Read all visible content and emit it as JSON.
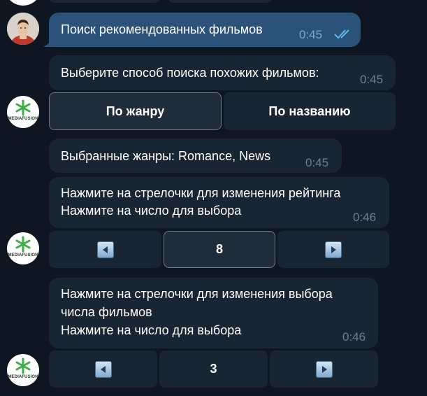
{
  "messages": {
    "user_query": {
      "text": "Поиск рекомендованных фильмов",
      "time": "0:45"
    },
    "choose_method": {
      "text": "Выберите способ поиска похожих фильмов:",
      "time": "0:45"
    },
    "method_buttons": [
      "По жанру",
      "По названию"
    ],
    "genres": {
      "text": "Выбранные жанры: Romance, News",
      "time": "0:45"
    },
    "rating": {
      "line1": "Нажмите на стрелочки для изменения рейтинга",
      "line2": "Нажмите на число для выбора",
      "time": "0:46",
      "value": "8"
    },
    "films_count": {
      "line1": "Нажмите на стрелочки для изменения выбора",
      "line2": "числа фильмов",
      "line3": "Нажмите на число для выбора",
      "time": "0:46",
      "value": "3"
    }
  },
  "bot": {
    "logo_text": "MEDIAFUSION"
  },
  "colors": {
    "background": "#0e1621",
    "incoming_bubble": "#182533",
    "outgoing_bubble": "#2b5278",
    "read_checks": "#64b5ef"
  },
  "icons": [
    "read-checkmarks-icon",
    "left-arrow-icon",
    "right-arrow-icon",
    "mediafusion-logo-icon",
    "user-avatar-icon"
  ]
}
